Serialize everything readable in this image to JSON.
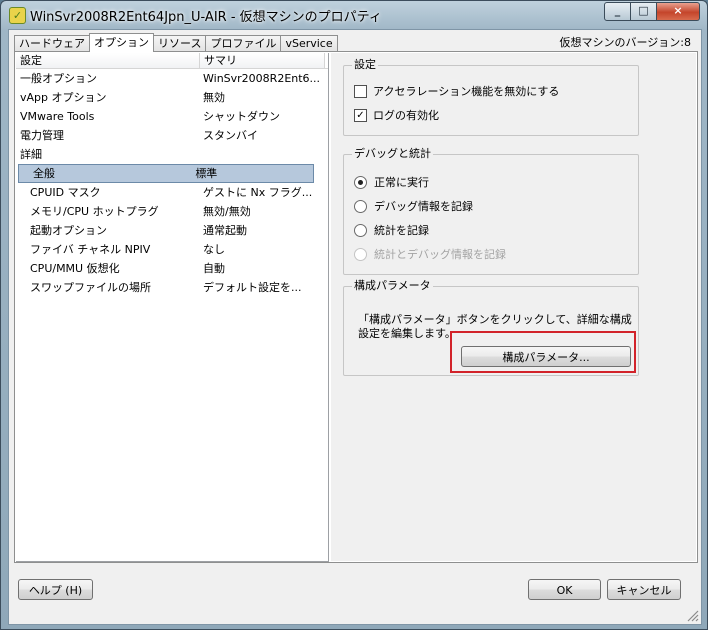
{
  "window": {
    "title": "WinSvr2008R2Ent64Jpn_U-AIR - 仮想マシンのプロパティ",
    "caption_min": "_",
    "caption_max": "□",
    "caption_close": "×",
    "icon": "vm-icon"
  },
  "tabs": [
    {
      "label": "ハードウェア"
    },
    {
      "label": "オプション"
    },
    {
      "label": "リソース"
    },
    {
      "label": "プロファイル"
    },
    {
      "label": "vService"
    }
  ],
  "version_text": "仮想マシンのバージョン:8",
  "list": {
    "headers": [
      "設定",
      "サマリ"
    ],
    "rows": [
      {
        "setting": "一般オプション",
        "summary": "WinSvr2008R2Ent6..."
      },
      {
        "setting": "vApp オプション",
        "summary": "無効"
      },
      {
        "setting": "VMware Tools",
        "summary": "シャットダウン"
      },
      {
        "setting": "電力管理",
        "summary": "スタンバイ"
      },
      {
        "setting": "詳細",
        "summary": ""
      },
      {
        "setting": "全般",
        "summary": "標準"
      },
      {
        "setting": "CPUID マスク",
        "summary": "ゲストに Nx フラグ..."
      },
      {
        "setting": "メモリ/CPU ホットプラグ",
        "summary": "無効/無効"
      },
      {
        "setting": "起動オプション",
        "summary": "通常起動"
      },
      {
        "setting": "ファイバ チャネル NPIV",
        "summary": "なし"
      },
      {
        "setting": "CPU/MMU 仮想化",
        "summary": "自動"
      },
      {
        "setting": "スワップファイルの場所",
        "summary": "デフォルト設定を..."
      }
    ]
  },
  "settings_group": {
    "label": "設定",
    "disable_accel": {
      "label": "アクセラレーション機能を無効にする",
      "checked": false
    },
    "enable_log": {
      "label": "ログの有効化",
      "checked": true
    },
    "check_mark": "✓"
  },
  "debug_group": {
    "label": "デバッグと統計",
    "options": [
      {
        "label": "正常に実行",
        "selected": true,
        "enabled": true
      },
      {
        "label": "デバッグ情報を記録",
        "selected": false,
        "enabled": true
      },
      {
        "label": "統計を記録",
        "selected": false,
        "enabled": true
      },
      {
        "label": "統計とデバッグ情報を記録",
        "selected": false,
        "enabled": false
      }
    ]
  },
  "config_group": {
    "label": "構成パラメータ",
    "description": "「構成パラメータ」ボタンをクリックして、詳細な構成設定を編集します。",
    "button_label": "構成パラメータ..."
  },
  "footer": {
    "help_label": "ヘルプ (H)",
    "ok_label": "OK",
    "cancel_label": "キャンセル"
  },
  "colors": {
    "selection": "#b6c8dc",
    "highlight": "#d2232a"
  }
}
